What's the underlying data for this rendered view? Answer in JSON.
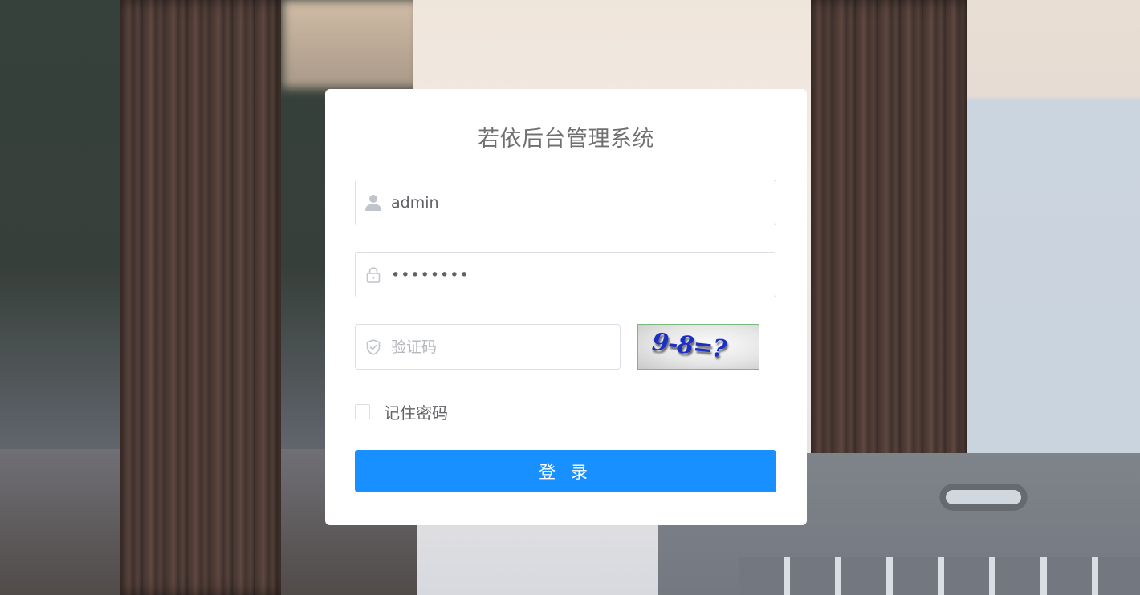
{
  "login": {
    "title": "若依后台管理系统",
    "username_value": "admin",
    "password_value": "••••••••",
    "captcha_placeholder": "验证码",
    "captcha_text": "9-8=?",
    "remember_label": "记住密码",
    "remember_checked": false,
    "submit_label": "登 录"
  },
  "icons": {
    "username": "user-icon",
    "password": "lock-icon",
    "captcha": "shield-check-icon"
  },
  "colors": {
    "primary": "#1890ff",
    "title": "#707070",
    "text": "#606266",
    "border": "#dcdfe6",
    "captcha_text": "#1a2fc7"
  }
}
